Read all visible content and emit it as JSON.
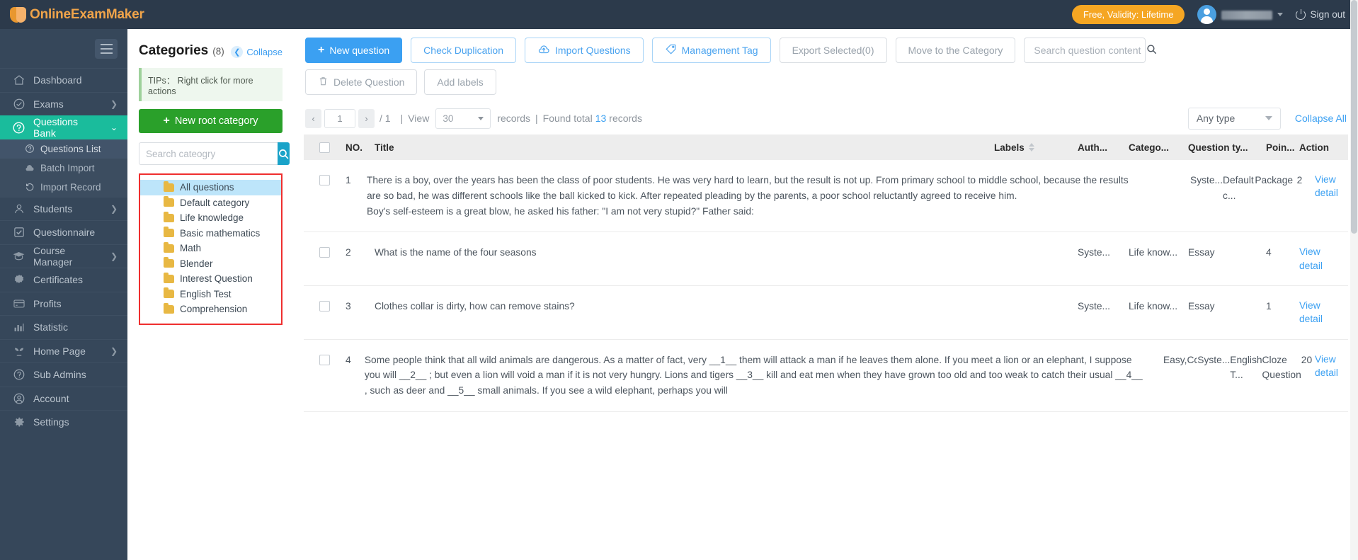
{
  "topbar": {
    "brand": "OnlineExamMaker",
    "validity_pill": "Free, Validity: Lifetime",
    "user_name_masked": "",
    "signout": "Sign out",
    "icons": {
      "power": "power-icon",
      "avatar": "avatar-icon",
      "caret": "chevron-down-icon"
    }
  },
  "sidebar": {
    "items": [
      {
        "label": "Dashboard",
        "icon": "home-icon",
        "active": false,
        "chevron": ""
      },
      {
        "label": "Exams",
        "icon": "check-circle-icon",
        "active": false,
        "chevron": "❯"
      },
      {
        "label": "Questions Bank",
        "icon": "question-circle-icon",
        "active": true,
        "chevron": "⌄"
      }
    ],
    "subitems": [
      {
        "label": "Questions List",
        "icon": "question-circle-icon",
        "selected": true
      },
      {
        "label": "Batch Import",
        "icon": "cloud-upload-icon",
        "selected": false
      },
      {
        "label": "Import Record",
        "icon": "history-icon",
        "selected": false
      }
    ],
    "items2": [
      {
        "label": "Students",
        "icon": "user-icon",
        "chevron": "❯"
      },
      {
        "label": "Questionnaire",
        "icon": "checkbox-icon",
        "chevron": ""
      },
      {
        "label": "Course Manager",
        "icon": "graduation-cap-icon",
        "chevron": "❯"
      },
      {
        "label": "Certificates",
        "icon": "badge-icon",
        "chevron": ""
      },
      {
        "label": "Profits",
        "icon": "card-icon",
        "chevron": ""
      },
      {
        "label": "Statistic",
        "icon": "bar-chart-icon",
        "chevron": ""
      },
      {
        "label": "Home Page",
        "icon": "sprout-icon",
        "chevron": "❯"
      },
      {
        "label": "Sub Admins",
        "icon": "question-circle-icon",
        "chevron": ""
      },
      {
        "label": "Account",
        "icon": "user-circle-icon",
        "chevron": ""
      },
      {
        "label": "Settings",
        "icon": "gear-icon",
        "chevron": ""
      }
    ]
  },
  "categories": {
    "title": "Categories",
    "count": "(8)",
    "collapse_label": "Collapse",
    "tips": "TIPs： Right click for more actions",
    "new_root_label": "New root category",
    "search_placeholder": "Search cateogry",
    "items": [
      {
        "label": "All questions",
        "selected": true
      },
      {
        "label": "Default category",
        "selected": false
      },
      {
        "label": "Life knowledge",
        "selected": false
      },
      {
        "label": "Basic mathematics",
        "selected": false
      },
      {
        "label": "Math",
        "selected": false
      },
      {
        "label": "Blender",
        "selected": false
      },
      {
        "label": "Interest Question",
        "selected": false
      },
      {
        "label": "English Test",
        "selected": false
      },
      {
        "label": "Comprehension",
        "selected": false
      }
    ]
  },
  "toolbar": {
    "new_question": "New question",
    "check_duplication": "Check Duplication",
    "import_questions": "Import Questions",
    "management_tag": "Management Tag",
    "export_selected": "Export Selected(0)",
    "move_to_category": "Move to the Category",
    "search_placeholder": "Search question content",
    "delete_question": "Delete Question",
    "add_labels": "Add labels"
  },
  "meta": {
    "prev": "‹",
    "page_value": "1",
    "next": "›",
    "total_pages": "/ 1",
    "view_label": "View",
    "page_size": "30",
    "records_label": "records",
    "found_prefix": "Found total",
    "found_count": "13",
    "found_suffix": "records",
    "type_filter": "Any type",
    "collapse_all": "Collapse All"
  },
  "table": {
    "headers": {
      "no": "NO.",
      "title": "Title",
      "labels": "Labels",
      "author": "Auth...",
      "category": "Catego...",
      "question_type": "Question ty...",
      "points": "Poin...",
      "action": "Action"
    },
    "rows": [
      {
        "no": "1",
        "title": "There is a boy, over the years has been the class of poor students. He was very hard to learn, but the result is not up. From primary school to middle school, because the results are so bad, he was different schools like the ball kicked to kick. After repeated pleading by the parents, a poor school reluctantly agreed to receive him.\nBoy's self-esteem is a great blow, he asked his father: \"I am not very stupid?\" Father said:",
        "labels": "",
        "author": "Syste...",
        "category": "Default c...",
        "question_type": "Package",
        "points": "2",
        "action": "View detail"
      },
      {
        "no": "2",
        "title": "What is the name of the four seasons",
        "labels": "",
        "author": "Syste...",
        "category": "Life know...",
        "question_type": "Essay",
        "points": "4",
        "action": "View detail"
      },
      {
        "no": "3",
        "title": "Clothes collar is dirty, how can remove stains?",
        "labels": "",
        "author": "Syste...",
        "category": "Life know...",
        "question_type": "Essay",
        "points": "1",
        "action": "View detail"
      },
      {
        "no": "4",
        "title": "Some people think that all wild animals are dangerous. As a matter of fact, very __1__ them will attack a man if he leaves them alone. If you meet a lion or an elephant, I suppose you will __2__ ; but even a lion will void a man if it is not very hungry. Lions and tigers __3__ kill and eat men when they have grown too old and too weak to catch their usual __4__ , such as deer and __5__ small animals. If you see a wild elephant, perhaps you will",
        "labels": "Easy,Common …",
        "author": "Syste...",
        "category": "English T...",
        "question_type": "Cloze Question",
        "points": "20",
        "action": "View detail"
      }
    ]
  },
  "colors": {
    "topbar": "#2c3a4b",
    "sidebar": "#36475a",
    "active": "#1abc9c",
    "primary": "#3ba0f2",
    "green": "#2aa02a",
    "orange": "#f5a623",
    "highlight_border": "#ef2f2f"
  }
}
